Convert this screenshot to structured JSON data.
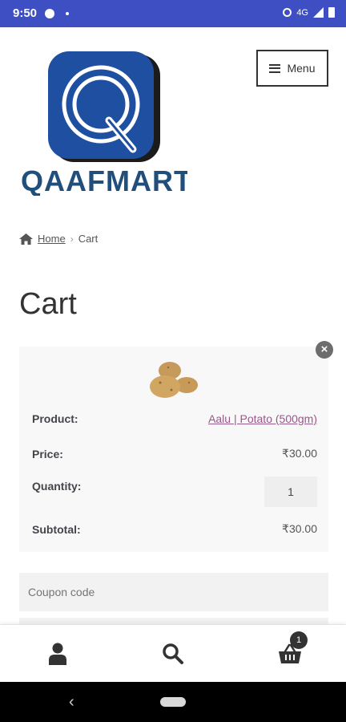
{
  "status_bar": {
    "time": "9:50",
    "network": "4G"
  },
  "header": {
    "logo_text": "QAAFMART",
    "menu_label": "Menu"
  },
  "breadcrumb": {
    "home": "Home",
    "separator": "›",
    "current": "Cart"
  },
  "page": {
    "title": "Cart"
  },
  "cart_item": {
    "product_label": "Product:",
    "product_name": "Aalu | Potato (500gm)",
    "price_label": "Price:",
    "price": "₹30.00",
    "quantity_label": "Quantity:",
    "quantity": "1",
    "subtotal_label": "Subtotal:",
    "subtotal": "₹30.00"
  },
  "coupon": {
    "placeholder": "Coupon code"
  },
  "bottom_nav": {
    "cart_count": "1"
  },
  "colors": {
    "status_bar": "#3e4fc4",
    "brand": "#1f4fa0",
    "link": "#96588a"
  }
}
